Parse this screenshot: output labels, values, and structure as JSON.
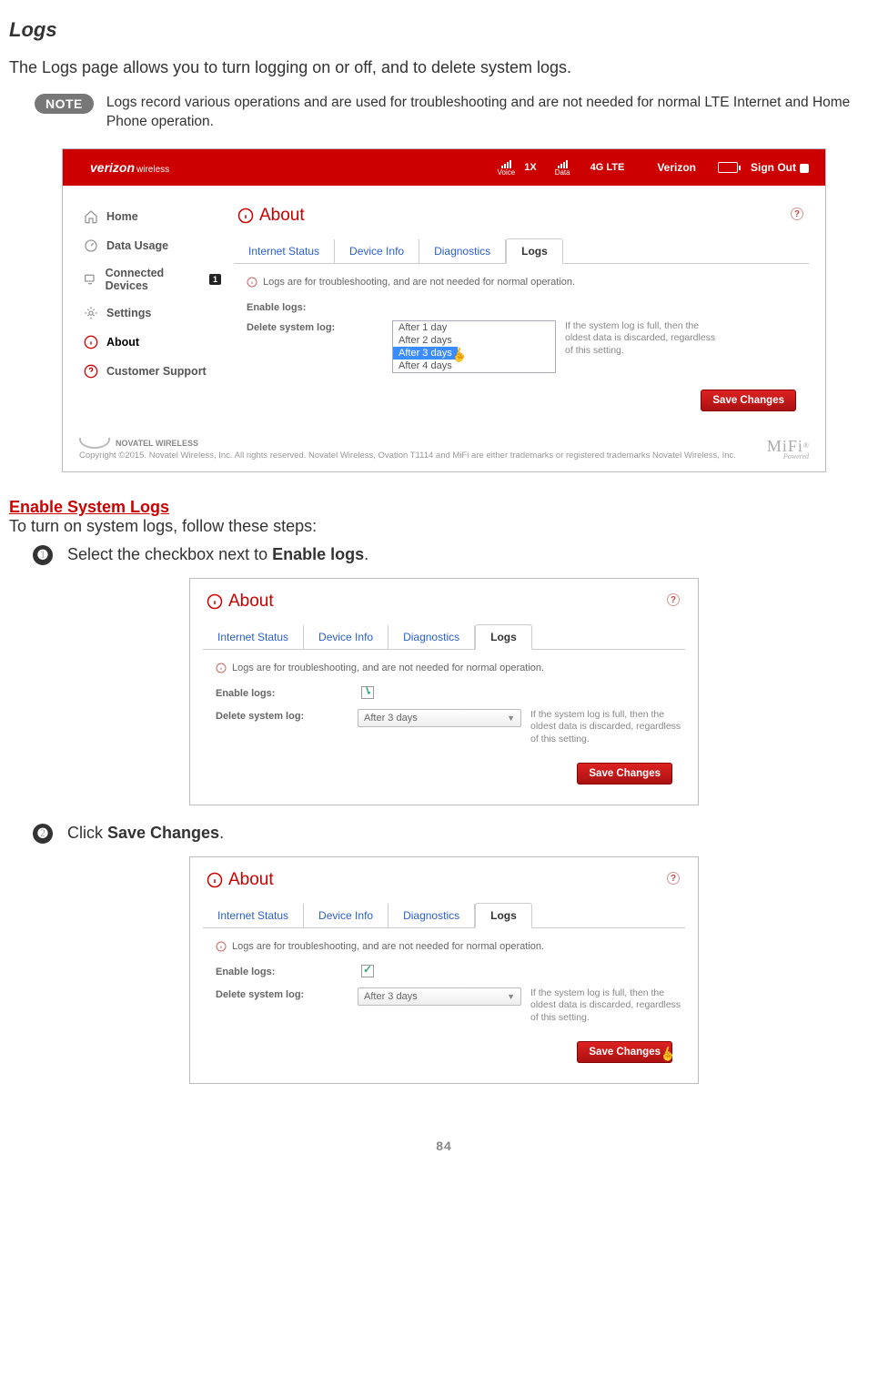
{
  "title": "Logs",
  "intro": "The Logs page allows you to turn logging on or off, and to delete system logs.",
  "note": {
    "badge": "NOTE",
    "text": "Logs record various operations and are used for troubleshooting and are not needed for normal LTE Internet and Home Phone operation."
  },
  "header": {
    "brand": "verizon",
    "brand_sub": "wireless",
    "sig1_lbl": "Voice",
    "sig1_net": "1X",
    "sig2_lbl": "Data",
    "net_4g": "4G LTE",
    "carrier": "Verizon",
    "signout": "Sign Out"
  },
  "nav": {
    "home": "Home",
    "data_usage": "Data Usage",
    "connected": "Connected Devices",
    "connected_badge": "1",
    "settings": "Settings",
    "about": "About",
    "support": "Customer Support"
  },
  "about_title": "About",
  "tabs": {
    "internet": "Internet Status",
    "device": "Device Info",
    "diag": "Diagnostics",
    "logs": "Logs"
  },
  "info_line": "Logs are for troubleshooting, and are not needed for normal operation.",
  "form": {
    "enable_label": "Enable logs:",
    "delete_label": "Delete system log:",
    "hint": "If the system log is full, then the oldest data is discarded, regardless of this setting."
  },
  "dd_options": {
    "o1": "After 1 day",
    "o2": "After 2 days",
    "o3": "After 3 days",
    "o4": "After 4 days"
  },
  "dd_selected": "After 3 days",
  "save_btn": "Save Changes",
  "footer": {
    "nw": "NOVATEL WIRELESS",
    "copy": "Copyright ©2015. Novatel Wireless, Inc. All rights reserved. Novatel Wireless, Ovation T1114 and MiFi are either trademarks or registered trademarks Novatel Wireless, Inc.",
    "mifi": "MiFi",
    "mifi_sub": "Powered"
  },
  "section2": {
    "heading": "Enable System Logs",
    "intro": "To turn on system logs, follow these steps:",
    "step1_pre": "Select the checkbox next to ",
    "step1_bold": "Enable logs",
    "step1_post": ".",
    "step2_pre": "Click ",
    "step2_bold": "Save Changes",
    "step2_post": "."
  },
  "page_number": "84"
}
